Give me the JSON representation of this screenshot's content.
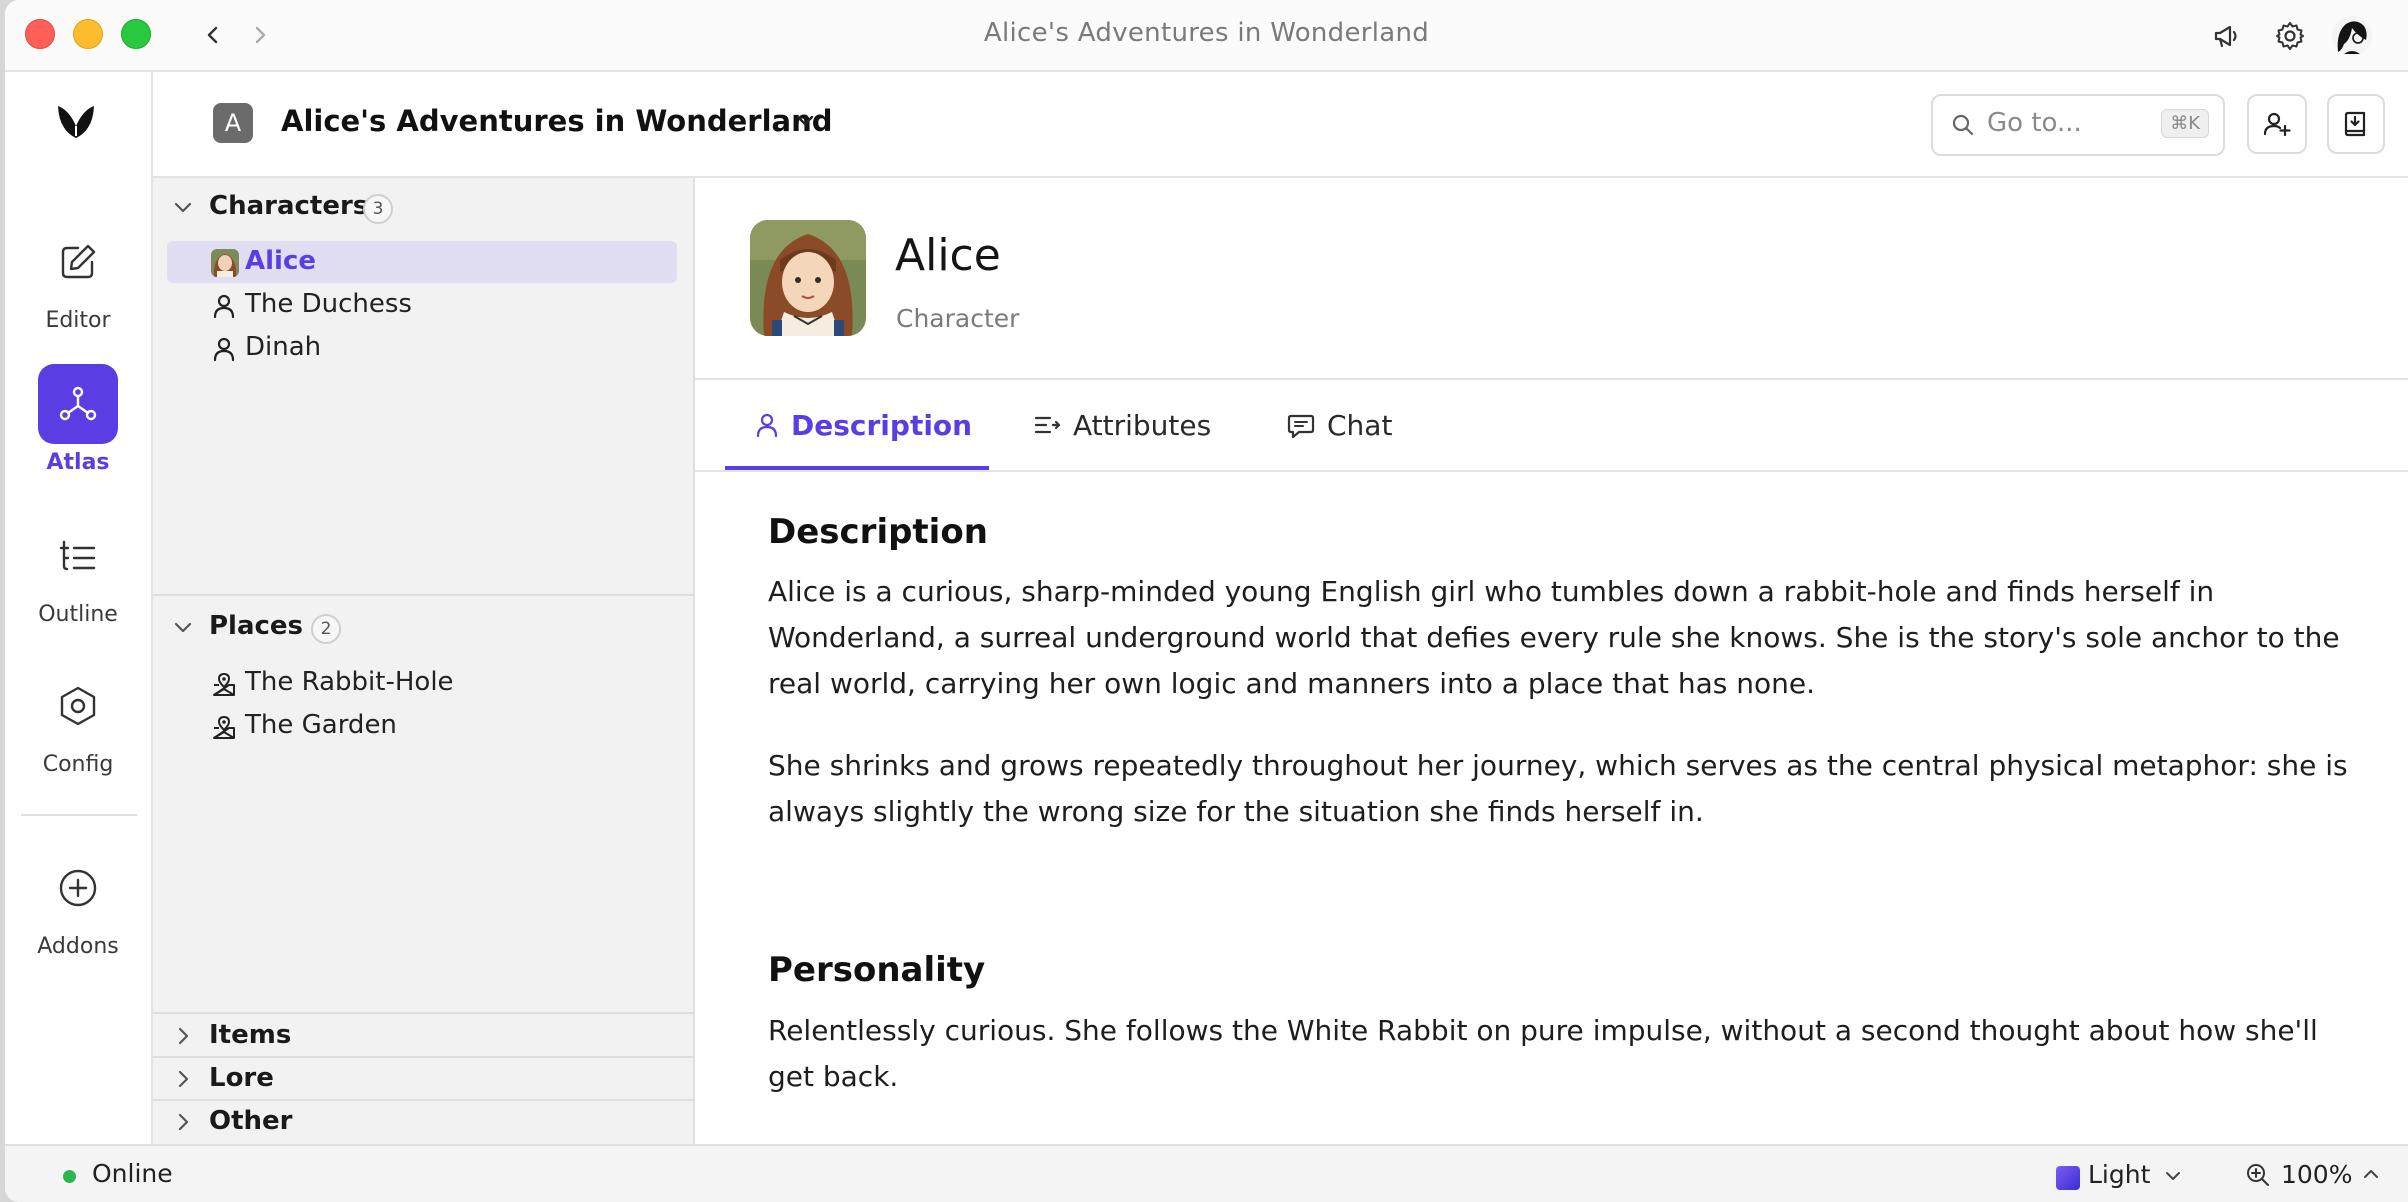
{
  "window": {
    "title": "Alice's Adventures in Wonderland"
  },
  "rail": {
    "items": [
      {
        "label": "Editor",
        "icon": "pencil-square-icon",
        "active": false
      },
      {
        "label": "Atlas",
        "icon": "graph-nodes-icon",
        "active": true
      },
      {
        "label": "Outline",
        "icon": "outline-tree-icon",
        "active": false
      },
      {
        "label": "Config",
        "icon": "hexagon-settings-icon",
        "active": false
      },
      {
        "label": "Addons",
        "icon": "plus-circle-icon",
        "active": false
      }
    ]
  },
  "header": {
    "project_badge": "A",
    "project_title": "Alice's Adventures in Wonderland",
    "search_placeholder": "Go to...",
    "search_shortcut": "⌘K"
  },
  "tree": {
    "sections": [
      {
        "title": "Characters",
        "count": "3",
        "expanded": true,
        "items": [
          {
            "label": "Alice",
            "icon": "portrait-thumb",
            "selected": true
          },
          {
            "label": "The Duchess",
            "icon": "person-icon",
            "selected": false
          },
          {
            "label": "Dinah",
            "icon": "person-icon",
            "selected": false
          }
        ]
      },
      {
        "title": "Places",
        "count": "2",
        "expanded": true,
        "items": [
          {
            "label": "The Rabbit-Hole",
            "icon": "map-pin-icon",
            "selected": false
          },
          {
            "label": "The Garden",
            "icon": "map-pin-icon",
            "selected": false
          }
        ]
      },
      {
        "title": "Items",
        "expanded": false
      },
      {
        "title": "Lore",
        "expanded": false
      },
      {
        "title": "Other",
        "expanded": false
      }
    ]
  },
  "detail": {
    "name": "Alice",
    "type": "Character",
    "tabs": [
      {
        "label": "Description",
        "active": true
      },
      {
        "label": "Attributes",
        "active": false
      },
      {
        "label": "Chat",
        "active": false
      }
    ],
    "sections": [
      {
        "heading": "Description",
        "paragraphs": [
          "Alice is a curious, sharp-minded young English girl who tumbles down a rabbit-hole and finds herself in Wonderland, a surreal underground world that defies every rule she knows. She is the story's sole anchor to the real world, carrying her own logic and manners into a place that has none.",
          "She shrinks and grows repeatedly throughout her journey, which serves as the central physical metaphor: she is always slightly the wrong size for the situation she finds herself in."
        ]
      },
      {
        "heading": "Personality",
        "paragraphs": [
          "Relentlessly curious. She follows the White Rabbit on pure impulse, without a second thought about how she'll get back."
        ]
      }
    ]
  },
  "status": {
    "connection": "Online",
    "theme": "Light",
    "zoom": "100%"
  },
  "colors": {
    "accent": "#5b3ee3",
    "online": "#2bb74d"
  }
}
